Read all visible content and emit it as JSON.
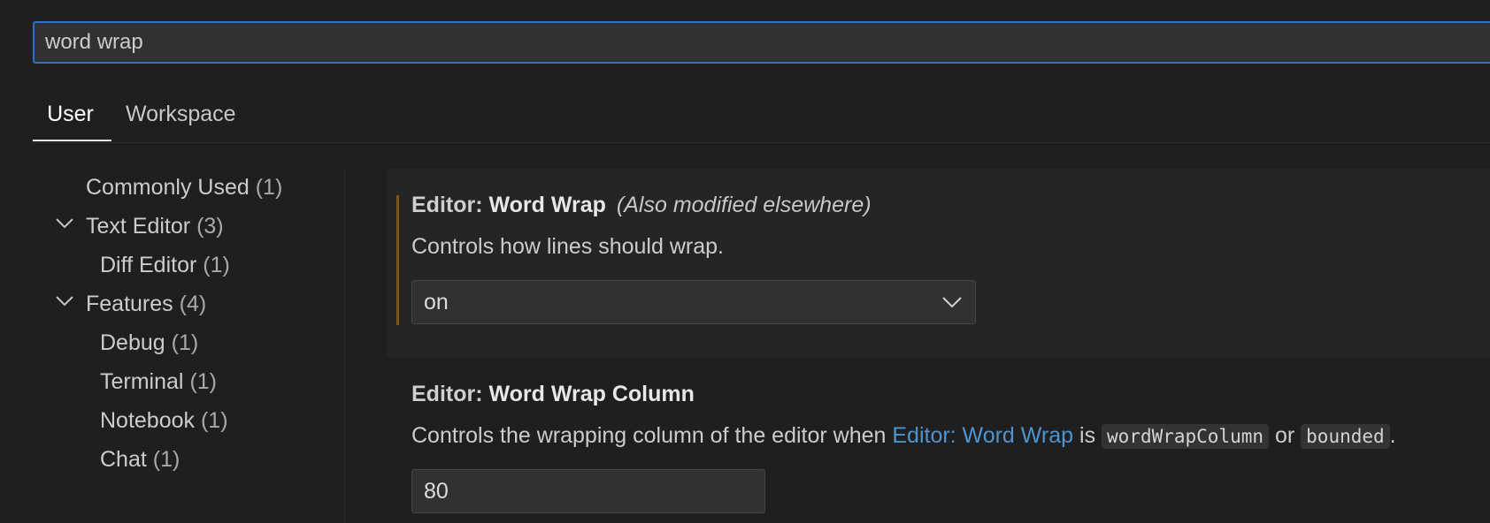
{
  "search": {
    "value": "word wrap"
  },
  "tabs": [
    {
      "label": "User",
      "active": true
    },
    {
      "label": "Workspace",
      "active": false
    }
  ],
  "toc": [
    {
      "label": "Commonly Used",
      "count": "(1)"
    },
    {
      "label": "Text Editor",
      "count": "(3)",
      "expanded": true
    },
    {
      "label": "Diff Editor",
      "count": "(1)"
    },
    {
      "label": "Features",
      "count": "(4)",
      "expanded": true
    },
    {
      "label": "Debug",
      "count": "(1)"
    },
    {
      "label": "Terminal",
      "count": "(1)"
    },
    {
      "label": "Notebook",
      "count": "(1)"
    },
    {
      "label": "Chat",
      "count": "(1)"
    }
  ],
  "settings": {
    "word_wrap": {
      "category": "Editor: ",
      "name": "Word Wrap",
      "modified_note": "(Also modified elsewhere)",
      "description": "Controls how lines should wrap.",
      "value": "on"
    },
    "word_wrap_column": {
      "category": "Editor: ",
      "name": "Word Wrap Column",
      "desc_prefix": "Controls the wrapping column of the editor when ",
      "desc_link": "Editor: Word Wrap",
      "desc_is": " is ",
      "desc_code1": "wordWrapColumn",
      "desc_or": " or ",
      "desc_code2": "bounded",
      "desc_end": ".",
      "value": "80"
    }
  },
  "colors": {
    "accent": "#2f6fc4",
    "link": "#4e94ce",
    "modified_bar": "#7a5a1c"
  }
}
